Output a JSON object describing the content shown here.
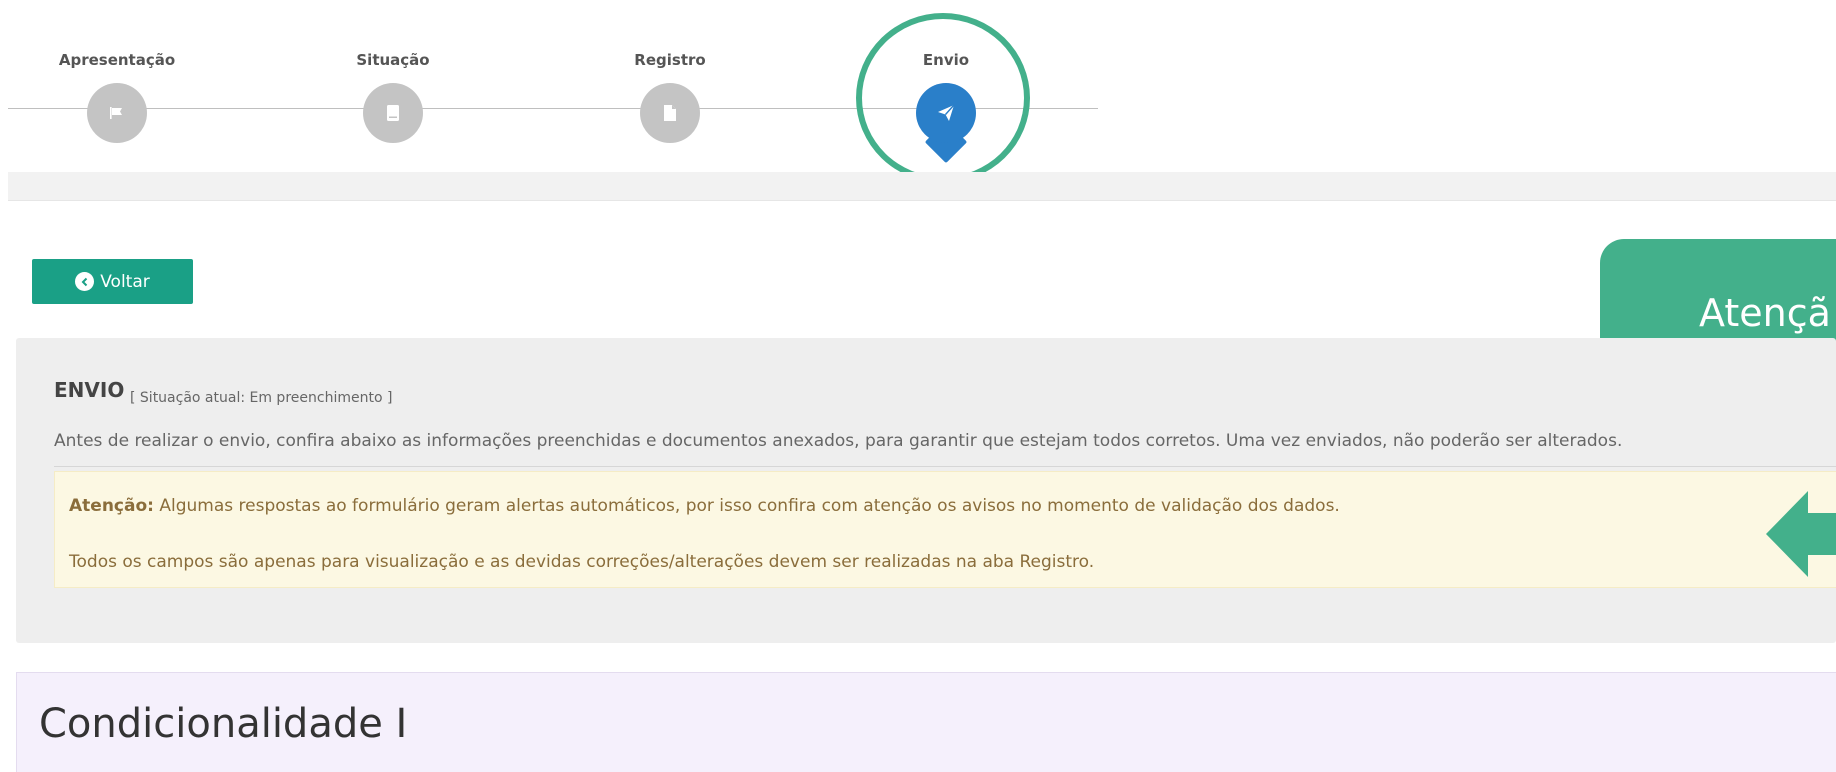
{
  "stepper": {
    "steps": [
      {
        "label": "Apresentação",
        "icon": "flag-icon",
        "active": false
      },
      {
        "label": "Situação",
        "icon": "book-icon",
        "active": false
      },
      {
        "label": "Registro",
        "icon": "file-icon",
        "active": false
      },
      {
        "label": "Envio",
        "icon": "paper-plane-icon",
        "active": true
      }
    ]
  },
  "back_button": {
    "label": "Voltar",
    "icon": "chevron-left-circle-icon"
  },
  "callout": {
    "text": "Atençã"
  },
  "envio": {
    "title": "ENVIO",
    "status": "[ Situação atual: Em preenchimento ]",
    "description": "Antes de realizar o envio, confira abaixo as informações preenchidas e documentos anexados, para garantir que estejam todos corretos. Uma vez enviados, não poderão ser alterados.",
    "alert": {
      "strong": "Atenção:",
      "line1": " Algumas respostas ao formulário geram alertas automáticos, por isso confira com atenção os avisos no momento de validação dos dados.",
      "line2": "Todos os campos são apenas para visualização e as devidas correções/alterações devem ser realizadas na aba Registro."
    }
  },
  "condicionalidade": {
    "title": "Condicionalidade I"
  },
  "colors": {
    "accent_green": "#1aa086",
    "callout_green": "#43b08b",
    "active_blue": "#2a7fc9",
    "inactive_grey": "#c4c4c4",
    "alert_bg": "#fcf8e3",
    "alert_text": "#8a6d3b"
  }
}
